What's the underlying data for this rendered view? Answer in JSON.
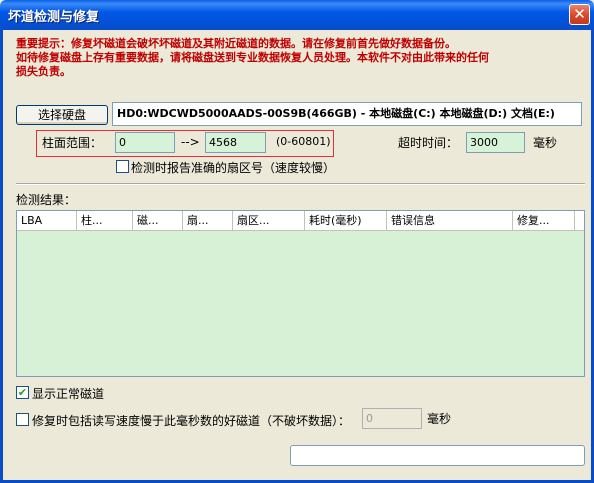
{
  "window": {
    "title": "坏道检测与修复",
    "close_glyph": "✕"
  },
  "warning": {
    "line1": "重要提示：修复坏磁道会破坏坏磁道及其附近磁道的数据。请在修复前首先做好数据备份。",
    "line2": "如待修复磁盘上存有重要数据，请将磁盘送到专业数据恢复人员处理。本软件不对由此带来的任何",
    "line3": "损失负责。"
  },
  "disk": {
    "button_label": "选择硬盘",
    "info": "HD0:WDCWD5000AADS-00S9B(466GB) - 本地磁盘(C:) 本地磁盘(D:) 文档(E:)"
  },
  "range": {
    "label": "柱面范围：",
    "start": "0",
    "arrow": "-->",
    "end": "4568",
    "max_hint": "(0-60801)"
  },
  "timeout": {
    "label": "超时时间：",
    "value": "3000",
    "unit": "毫秒"
  },
  "accurate_sector": {
    "label": "检测时报告准确的扇区号（速度较慢）",
    "checked": false
  },
  "results": {
    "label": "检测结果：",
    "columns": [
      "LBA",
      "柱...",
      "磁...",
      "扇...",
      "扇区...",
      "耗时(毫秒)",
      "错误信息",
      "修复..."
    ]
  },
  "show_normal": {
    "label": "显示正常磁道",
    "checked": true
  },
  "repair_slow": {
    "label": "修复时包括读写速度慢于此毫秒数的好磁道（不破坏数据）：",
    "value": "0",
    "unit": "毫秒",
    "checked": false
  }
}
